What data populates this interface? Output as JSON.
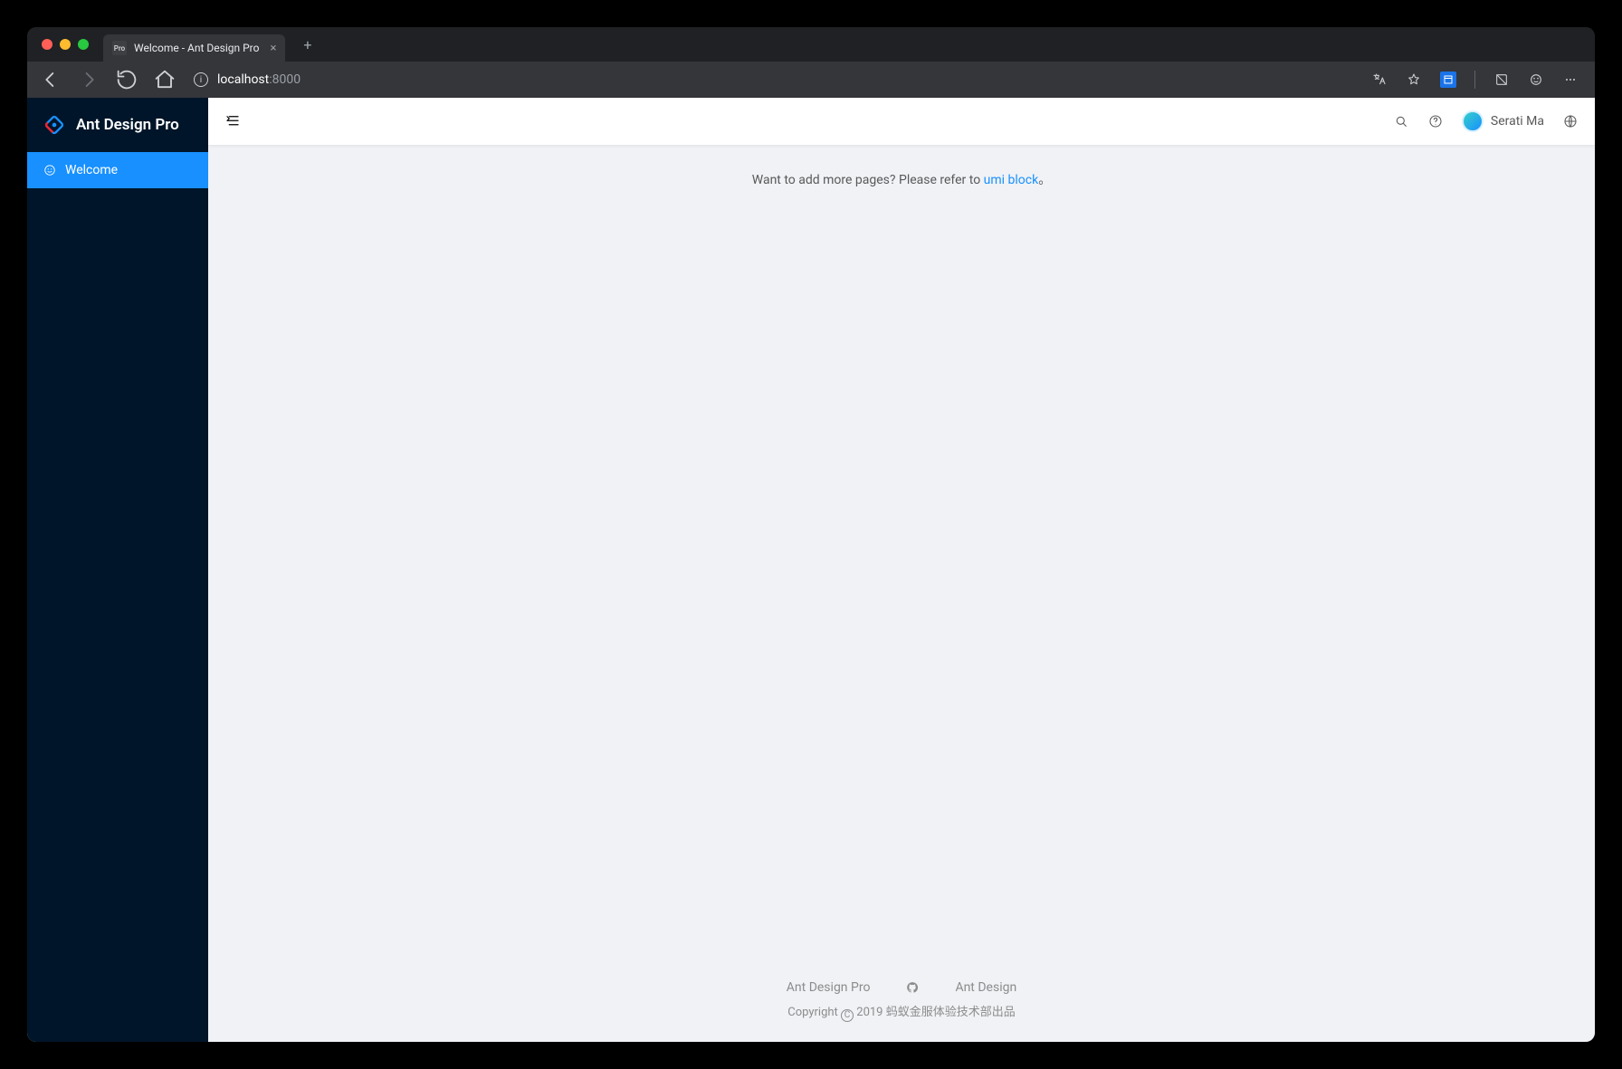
{
  "browser": {
    "tab_title": "Welcome - Ant Design Pro",
    "tab_favicon_text": "Pro",
    "url_host": "localhost",
    "url_port": ":8000"
  },
  "sidebar": {
    "brand": "Ant Design Pro",
    "items": [
      {
        "label": "Welcome",
        "icon": "smile-icon",
        "active": true
      }
    ]
  },
  "header": {
    "username": "Serati Ma"
  },
  "content": {
    "message_prefix": "Want to add more pages? Please refer to ",
    "message_link_text": "umi block",
    "message_suffix": "。"
  },
  "footer": {
    "links": [
      {
        "label": "Ant Design Pro"
      },
      {
        "label_icon": "github-icon"
      },
      {
        "label": "Ant Design"
      }
    ],
    "copyright_prefix": "Copyright ",
    "copyright_year": "2019",
    "copyright_owner": " 蚂蚁金服体验技术部出品"
  }
}
